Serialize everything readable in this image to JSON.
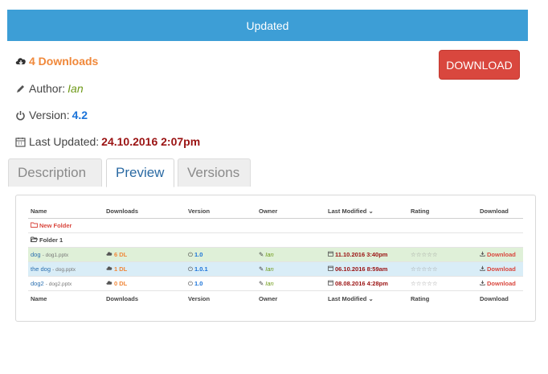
{
  "banner": {
    "text": "Updated"
  },
  "info": {
    "downloads": "4 Downloads",
    "author_label": "Author:",
    "author": "Ian",
    "version_label": "Version:",
    "version": "4.2",
    "updated_label": "Last Updated:",
    "updated": "24.10.2016 2:07pm"
  },
  "download_button": "DOWNLOAD",
  "tabs": [
    {
      "label": "Description",
      "active": false
    },
    {
      "label": "Preview",
      "active": true
    },
    {
      "label": "Versions",
      "active": false
    }
  ],
  "table": {
    "headers": [
      "Name",
      "Downloads",
      "Version",
      "Owner",
      "Last Modified",
      "Rating",
      "Download"
    ],
    "new_folder": "New Folder",
    "folder": "Folder 1",
    "rows": [
      {
        "name": "dog",
        "file": "- dog1.pptx",
        "downloads": "6 DL",
        "version": "1.0",
        "owner": "Ian",
        "modified": "11.10.2016 3:40pm",
        "rating": "☆☆☆☆☆",
        "download": "Download"
      },
      {
        "name": "the dog",
        "file": "- dog.pptx",
        "downloads": "1 DL",
        "version": "1.0.1",
        "owner": "Ian",
        "modified": "06.10.2016 8:59am",
        "rating": "☆☆☆☆☆",
        "download": "Download"
      },
      {
        "name": "dog2",
        "file": "- dog2.pptx",
        "downloads": "0 DL",
        "version": "1.0",
        "owner": "Ian",
        "modified": "08.08.2016 4:28pm",
        "rating": "☆☆☆☆☆",
        "download": "Download"
      }
    ]
  },
  "colors": {
    "banner": "#3d9ed6",
    "download_button": "#d9473e",
    "downloads_orange": "#f0883a",
    "author_green": "#6f9a19",
    "version_blue": "#1a73d9",
    "date_red": "#9a1212",
    "row_green": "#dff0d8",
    "row_blue": "#d9edf7"
  },
  "icons": [
    "cloud-download-icon",
    "pencil-icon",
    "power-icon",
    "calendar-icon",
    "folder-icon",
    "chevron-down-icon",
    "download-icon"
  ]
}
